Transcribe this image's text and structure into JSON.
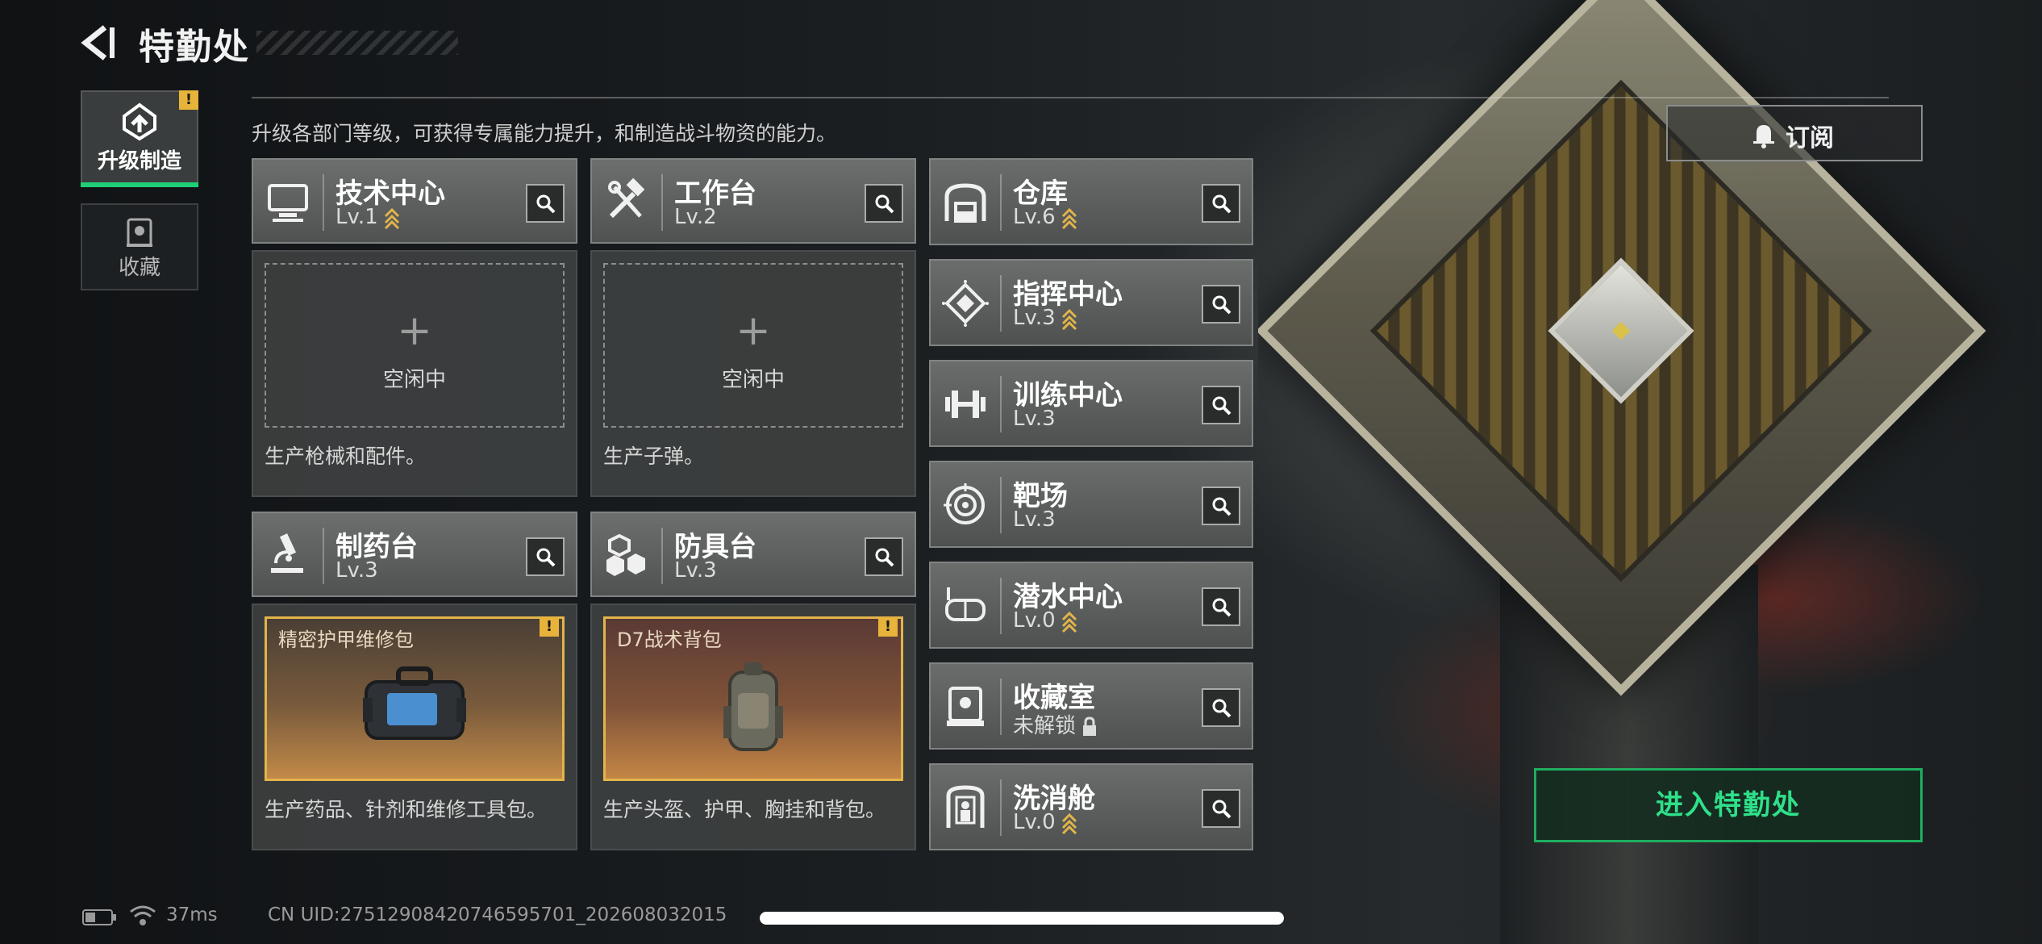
{
  "header": {
    "title": "特勤处",
    "subtitle": "升级各部门等级，可获得专属能力提升，和制造战斗物资的能力。",
    "subscribe_label": "订阅"
  },
  "tabs": [
    {
      "label": "升级制造",
      "active": true,
      "icon": "upgrade-icon",
      "badge": "!"
    },
    {
      "label": "收藏",
      "active": false,
      "icon": "collection-icon"
    }
  ],
  "production": [
    {
      "name": "技术中心",
      "level": "Lv.1",
      "upgradable": true,
      "icon": "computer-icon",
      "slot_status": "空闲中",
      "description": "生产枪械和配件。"
    },
    {
      "name": "工作台",
      "level": "Lv.2",
      "upgradable": false,
      "icon": "tools-icon",
      "slot_status": "空闲中",
      "description": "生产子弹。"
    },
    {
      "name": "制药台",
      "level": "Lv.3",
      "upgradable": false,
      "icon": "microscope-icon",
      "item": "精密护甲维修包",
      "badge": "!",
      "description": "生产药品、针剂和维修工具包。"
    },
    {
      "name": "防具台",
      "level": "Lv.3",
      "upgradable": false,
      "icon": "armor-blocks-icon",
      "item": "D7战术背包",
      "badge": "!",
      "description": "生产头盔、护甲、胸挂和背包。"
    }
  ],
  "facilities": [
    {
      "name": "仓库",
      "level": "Lv.6",
      "upgradable": true,
      "icon": "warehouse-icon"
    },
    {
      "name": "指挥中心",
      "level": "Lv.3",
      "upgradable": true,
      "icon": "command-icon"
    },
    {
      "name": "训练中心",
      "level": "Lv.3",
      "upgradable": false,
      "icon": "dumbbell-icon"
    },
    {
      "name": "靶场",
      "level": "Lv.3",
      "upgradable": false,
      "icon": "target-icon"
    },
    {
      "name": "潜水中心",
      "level": "Lv.0",
      "upgradable": true,
      "icon": "diving-mask-icon"
    },
    {
      "name": "收藏室",
      "level": "未解锁",
      "locked": true,
      "icon": "display-case-icon"
    },
    {
      "name": "洗消舱",
      "level": "Lv.0",
      "upgradable": true,
      "icon": "decon-pod-icon"
    }
  ],
  "enter_button": "进入特勤处",
  "status_bar": {
    "ping": "37ms",
    "uid": "CN UID:27512908420746595701_202608032015"
  },
  "colors": {
    "accent_green": "#1fcf77",
    "upgrade_gold": "#e2b44a",
    "warning": "#e7b33a"
  }
}
